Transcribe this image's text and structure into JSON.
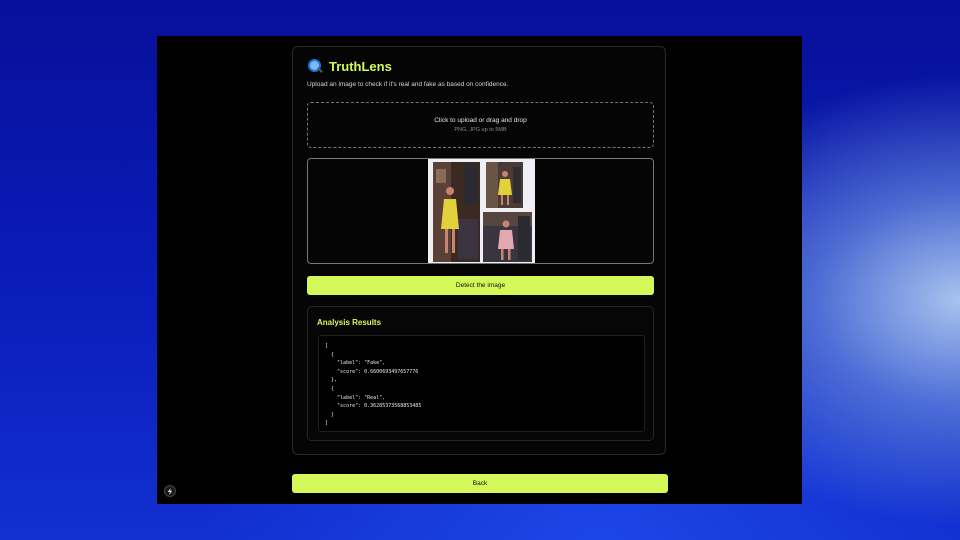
{
  "app": {
    "title": "TruthLens",
    "subtitle": "Upload an image to check if it's real and fake as based on confidence."
  },
  "upload": {
    "main_text": "Click to upload or drag and drop",
    "hint_text": "PNG, JPG up to 5MB"
  },
  "detect_button": {
    "label": "Detect the image"
  },
  "results": {
    "title": "Analysis Results",
    "json_text": "[\n  {\n    \"label\": \"Fake\",\n    \"score\": 0.6600693497657776\n  },\n  {\n    \"label\": \"Real\",\n    \"score\": 0.36285373568853485\n  }\n]"
  },
  "back_button": {
    "label": "Back"
  },
  "icons": {
    "logo": "magnifier-icon",
    "dev_indicator": "lightning-icon"
  },
  "colors": {
    "accent": "#d4f85a",
    "background": "#000000"
  }
}
